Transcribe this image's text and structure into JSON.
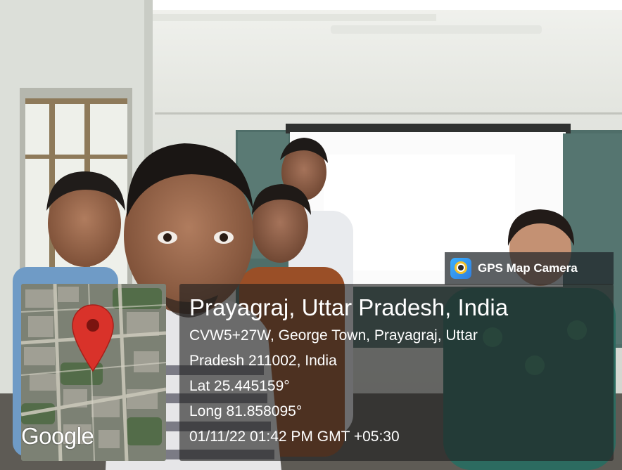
{
  "overlay": {
    "app_name": "GPS Map Camera",
    "app_icon": "gps-map-camera-app-icon",
    "location_title": "Prayagraj, Uttar Pradesh, India",
    "address_line_1": "CVW5+27W, George Town, Prayagraj, Uttar",
    "address_line_2": "Pradesh 211002, India",
    "latitude": "Lat 25.445159°",
    "longitude": "Long 81.858095°",
    "timestamp": "01/11/22 01:42 PM GMT +05:30"
  },
  "map": {
    "attribution": "Google",
    "marker_icon": "map-pin-icon",
    "marker_color": "#d9322a"
  },
  "colors": {
    "panel_background": "#1e1e1e",
    "text": "#ffffff",
    "pin": "#d9322a"
  }
}
